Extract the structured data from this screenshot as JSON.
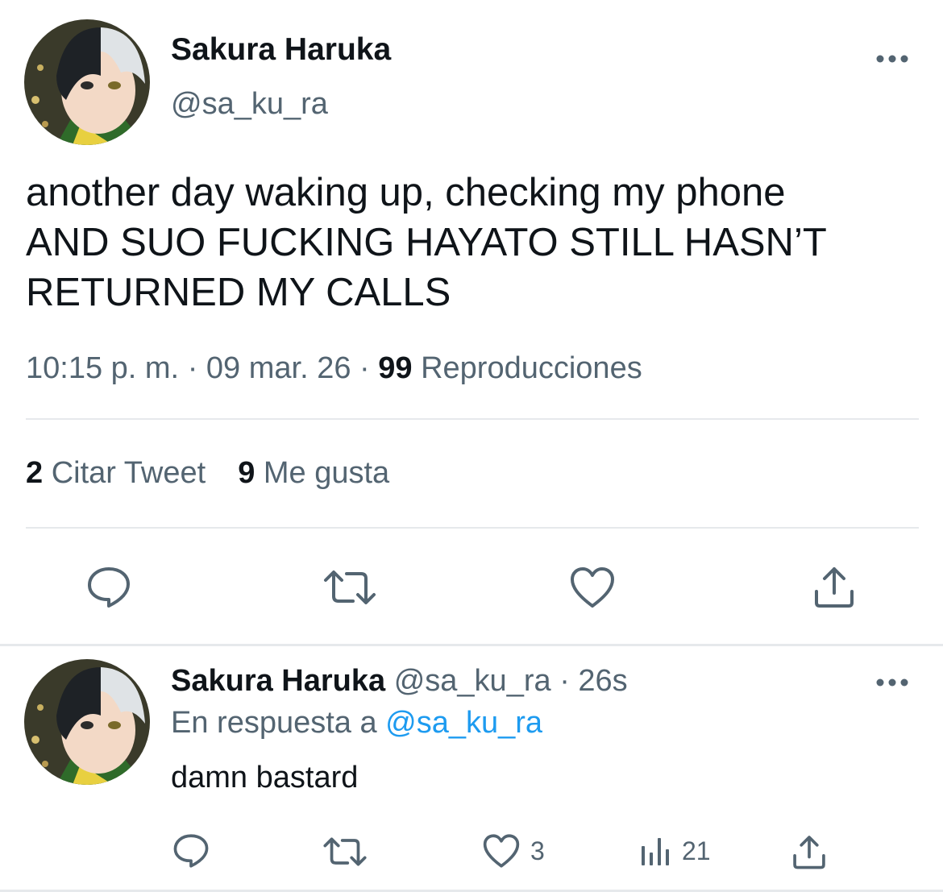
{
  "main_tweet": {
    "author": {
      "name": "Sakura Haruka",
      "handle": "@sa_ku_ra"
    },
    "text_lines": [
      "another day waking up, checking my phone",
      "AND SUO FUCKING HAYATO STILL HASN’T",
      "RETURNED MY CALLS"
    ],
    "time": "10:15 p. m.",
    "separator": "·",
    "date": "09 mar. 26",
    "views_count": "99",
    "views_label": "Reproducciones",
    "stats": {
      "quote_count": "2",
      "quote_label": "Citar Tweet",
      "like_count": "9",
      "like_label": "Me gusta"
    },
    "actions": [
      "reply-icon",
      "retweet-icon",
      "heart-icon",
      "share-icon"
    ]
  },
  "reply_tweet": {
    "author": {
      "name": "Sakura Haruka",
      "handle": "@sa_ku_ra"
    },
    "separator": "·",
    "time_ago": "26s",
    "replying_to_label": "En respuesta a",
    "replying_to_handle": "@sa_ku_ra",
    "text": "damn bastard",
    "like_count": "3",
    "views_count": "21",
    "actions": [
      "reply-icon",
      "retweet-icon",
      "heart-icon",
      "views-icon",
      "share-icon"
    ]
  },
  "colors": {
    "text": "#0f1419",
    "secondary": "#536471",
    "link": "#1d9bf0",
    "divider": "#e6e9ec"
  }
}
